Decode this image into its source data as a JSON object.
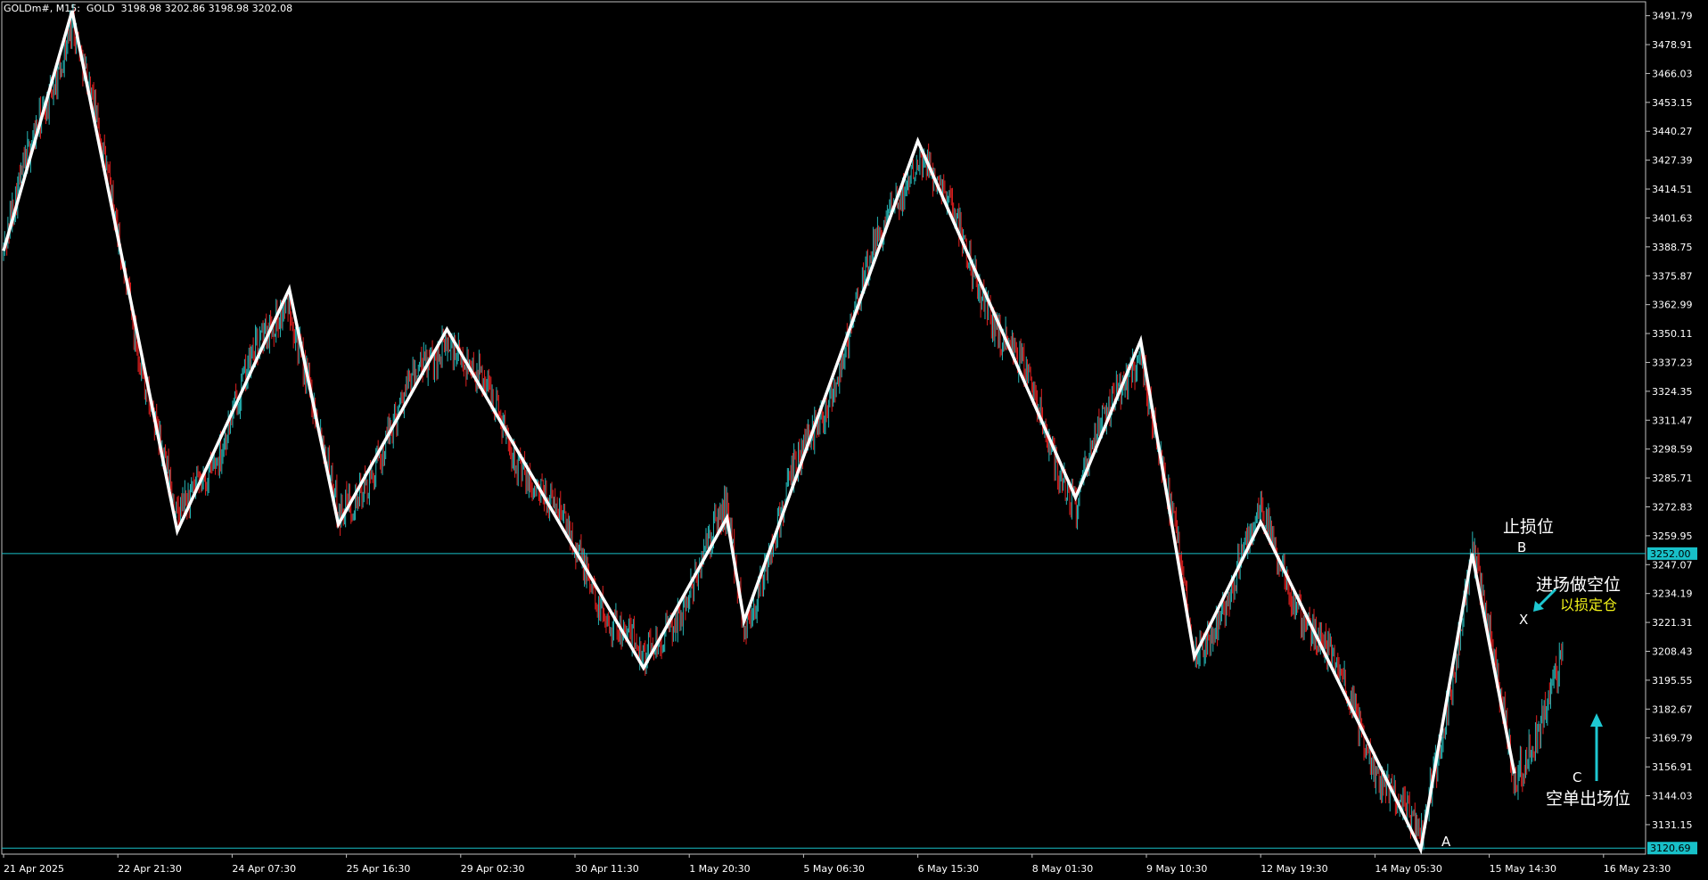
{
  "header": {
    "symbol": "GOLDm#, M15:  GOLD  3198.98 3202.86 3198.98 3202.08"
  },
  "colors": {
    "background": "#000000",
    "frame": "#c0c0c0",
    "bull": "#26b5b5",
    "bear": "#e02020",
    "zigzag": "#ffffff",
    "level": "#18c0c8",
    "arrow": "#1ec8d2",
    "note": "#f2f21a"
  },
  "annotations": {
    "stop_loss": "止损位",
    "entry_short": "进场做空位",
    "position_sizing": "以损定仓",
    "exit_short": "空单出场位",
    "point_a": "A",
    "point_b": "B",
    "point_c": "C",
    "point_x": "X"
  },
  "chart_data": {
    "type": "candlestick",
    "title": "",
    "symbol": "GOLD",
    "timeframe": "M15",
    "x_tick_labels": [
      "21 Apr 2025",
      "22 Apr 21:30",
      "24 Apr 07:30",
      "25 Apr 16:30",
      "29 Apr 02:30",
      "30 Apr 11:30",
      "1 May 20:30",
      "5 May 06:30",
      "6 May 15:30",
      "8 May 01:30",
      "9 May 10:30",
      "12 May 19:30",
      "14 May 05:30",
      "15 May 14:30",
      "16 May 23:30"
    ],
    "y_tick_labels": [
      "3491.79",
      "3478.91",
      "3466.03",
      "3453.15",
      "3440.27",
      "3427.39",
      "3414.51",
      "3401.63",
      "3388.75",
      "3375.87",
      "3362.99",
      "3350.11",
      "3337.23",
      "3324.35",
      "3311.47",
      "3298.59",
      "3285.71",
      "3272.83",
      "3259.95",
      "3247.07",
      "3234.19",
      "3221.31",
      "3208.43",
      "3195.55",
      "3182.67",
      "3169.79",
      "3156.91",
      "3144.03",
      "3131.15"
    ],
    "ylim": [
      3118,
      3498
    ],
    "x_count": 15,
    "horizontal_line": 3252.0,
    "horizontal_line_label": "3252.00",
    "current_price_label": "3120.69",
    "zigzag": [
      {
        "x": 0.0,
        "y": 3387
      },
      {
        "x": 0.6,
        "y": 3494
      },
      {
        "x": 1.52,
        "y": 3262
      },
      {
        "x": 2.5,
        "y": 3370
      },
      {
        "x": 2.93,
        "y": 3265
      },
      {
        "x": 3.88,
        "y": 3352
      },
      {
        "x": 5.6,
        "y": 3201
      },
      {
        "x": 6.33,
        "y": 3268
      },
      {
        "x": 6.48,
        "y": 3222
      },
      {
        "x": 8.0,
        "y": 3436
      },
      {
        "x": 9.38,
        "y": 3277
      },
      {
        "x": 9.95,
        "y": 3347
      },
      {
        "x": 10.42,
        "y": 3206
      },
      {
        "x": 11.0,
        "y": 3266
      },
      {
        "x": 12.4,
        "y": 3120
      },
      {
        "x": 12.85,
        "y": 3252
      },
      {
        "x": 13.22,
        "y": 3154
      }
    ]
  }
}
